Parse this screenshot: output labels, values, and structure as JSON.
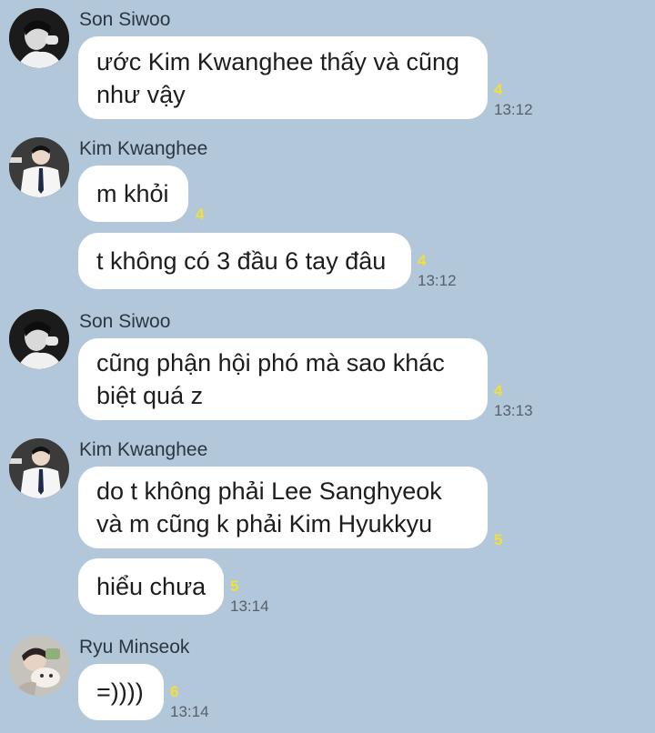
{
  "colors": {
    "background": "#b3c7da",
    "bubble": "#ffffff",
    "unread": "#f3df36"
  },
  "messages": [
    {
      "sender": "Son Siwoo",
      "avatar": "son-siwoo-avatar-icon",
      "lines": [
        "ước Kim Kwanghee thấy và cũng",
        "như vậy"
      ],
      "unread": "4",
      "time": "13:12"
    },
    {
      "sender": "Kim Kwanghee",
      "avatar": "kim-kwanghee-avatar-icon",
      "lines": [
        "m khỏi"
      ],
      "unread": "4",
      "time": ""
    },
    {
      "sender": "",
      "lines": [
        "t không có 3 đầu 6 tay đâu"
      ],
      "unread": "4",
      "time": "13:12"
    },
    {
      "sender": "Son Siwoo",
      "avatar": "son-siwoo-avatar-icon",
      "lines": [
        "cũng phận hội phó mà sao khác",
        "biệt quá z"
      ],
      "unread": "4",
      "time": "13:13"
    },
    {
      "sender": "Kim Kwanghee",
      "avatar": "kim-kwanghee-avatar-icon",
      "lines": [
        "do t không phải Lee Sanghyeok",
        "và m cũng k phải Kim Hyukkyu"
      ],
      "unread": "5",
      "time": ""
    },
    {
      "sender": "",
      "lines": [
        "hiểu chưa"
      ],
      "unread": "5",
      "time": "13:14"
    },
    {
      "sender": "Ryu Minseok",
      "avatar": "ryu-minseok-avatar-icon",
      "lines": [
        "=))))"
      ],
      "unread": "6",
      "time": "13:14"
    }
  ]
}
